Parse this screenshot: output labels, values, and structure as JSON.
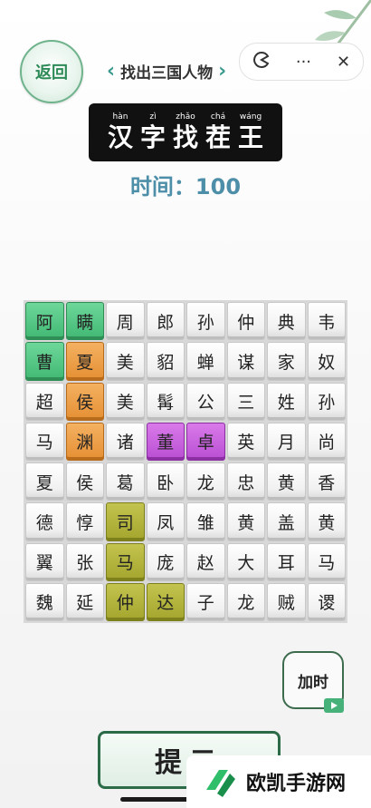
{
  "back_label": "返回",
  "capsule": {
    "icon1": "pacman-icon",
    "more": "···",
    "close": "✕"
  },
  "level_title": "找出三国人物",
  "logo": [
    {
      "py": "hàn",
      "hz": "汉"
    },
    {
      "py": "zì",
      "hz": "字"
    },
    {
      "py": "zhǎo",
      "hz": "找"
    },
    {
      "py": "chá",
      "hz": "茬"
    },
    {
      "py": "wáng",
      "hz": "王"
    }
  ],
  "timer_text": "时间：100",
  "grid": [
    [
      {
        "c": "阿",
        "s": "green"
      },
      {
        "c": "瞒",
        "s": "green"
      },
      {
        "c": "周"
      },
      {
        "c": "郎"
      },
      {
        "c": "孙"
      },
      {
        "c": "仲"
      },
      {
        "c": "典"
      },
      {
        "c": "韦"
      }
    ],
    [
      {
        "c": "曹",
        "s": "green"
      },
      {
        "c": "夏",
        "s": "orange"
      },
      {
        "c": "美"
      },
      {
        "c": "貂"
      },
      {
        "c": "蝉"
      },
      {
        "c": "谋"
      },
      {
        "c": "家"
      },
      {
        "c": "奴"
      }
    ],
    [
      {
        "c": "超"
      },
      {
        "c": "侯",
        "s": "orange"
      },
      {
        "c": "美"
      },
      {
        "c": "髯"
      },
      {
        "c": "公"
      },
      {
        "c": "三"
      },
      {
        "c": "姓"
      },
      {
        "c": "孙"
      }
    ],
    [
      {
        "c": "马"
      },
      {
        "c": "渊",
        "s": "orange"
      },
      {
        "c": "诸"
      },
      {
        "c": "董",
        "s": "purple"
      },
      {
        "c": "卓",
        "s": "purple"
      },
      {
        "c": "英"
      },
      {
        "c": "月"
      },
      {
        "c": "尚"
      }
    ],
    [
      {
        "c": "夏"
      },
      {
        "c": "侯"
      },
      {
        "c": "葛"
      },
      {
        "c": "卧"
      },
      {
        "c": "龙"
      },
      {
        "c": "忠"
      },
      {
        "c": "黄"
      },
      {
        "c": "香"
      }
    ],
    [
      {
        "c": "德"
      },
      {
        "c": "惇"
      },
      {
        "c": "司",
        "s": "olive"
      },
      {
        "c": "凤"
      },
      {
        "c": "雏"
      },
      {
        "c": "黄"
      },
      {
        "c": "盖"
      },
      {
        "c": "黄"
      }
    ],
    [
      {
        "c": "翼"
      },
      {
        "c": "张"
      },
      {
        "c": "马",
        "s": "olive"
      },
      {
        "c": "庞"
      },
      {
        "c": "赵"
      },
      {
        "c": "大"
      },
      {
        "c": "耳"
      },
      {
        "c": "马"
      }
    ],
    [
      {
        "c": "魏"
      },
      {
        "c": "延"
      },
      {
        "c": "仲",
        "s": "olive"
      },
      {
        "c": "达",
        "s": "olive"
      },
      {
        "c": "子"
      },
      {
        "c": "龙"
      },
      {
        "c": "贼"
      },
      {
        "c": "谡"
      }
    ]
  ],
  "addtime_label": "加时",
  "hint_label": "提示",
  "watermark": "欧凯手游网",
  "colors": {
    "green": "#41b873",
    "orange": "#e58f33",
    "purple": "#b94ed3",
    "olive": "#a3a52d",
    "timer": "#4d8ea8"
  }
}
